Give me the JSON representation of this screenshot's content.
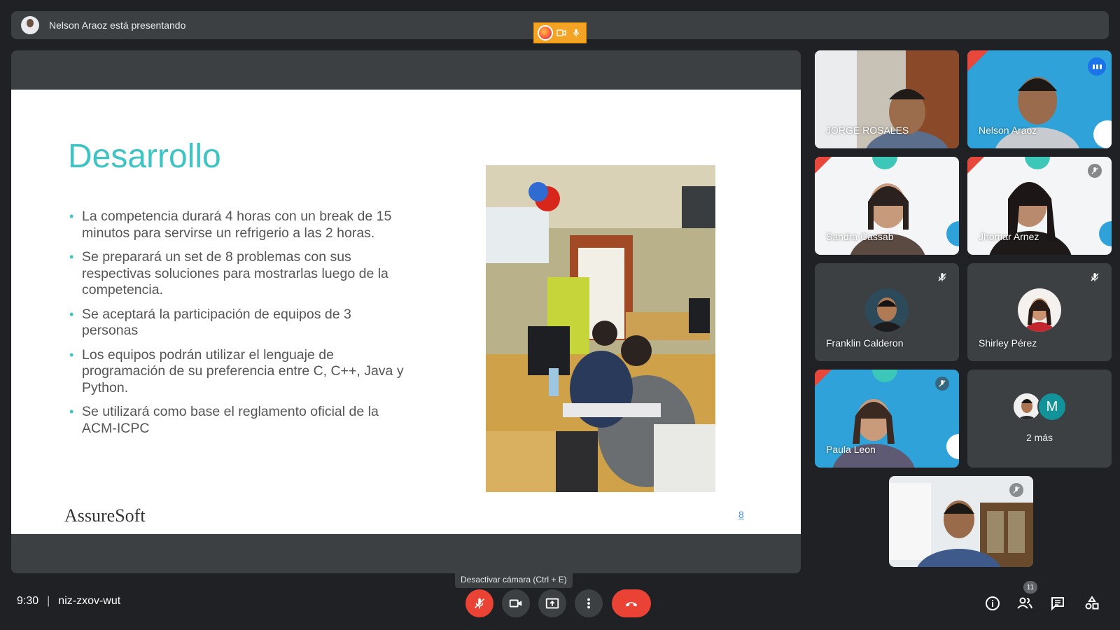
{
  "presenter": {
    "text": "Nelson Araoz está presentando"
  },
  "slide": {
    "title": "Desarrollo",
    "bullets": [
      "La competencia durará 4 horas con un break de 15 minutos para servirse un refrigerio a las 2 horas.",
      "Se preparará un set de 8 problemas con sus respectivas soluciones para mostrarlas luego de la competencia.",
      "Se aceptará la participación de equipos de 3 personas",
      "Los equipos podrán utilizar el lenguaje de programación de su preferencia entre C, C++, Java y Python.",
      "Se utilizará como base el reglamento oficial de la ACM-ICPC"
    ],
    "logo": "AssureSoft",
    "page_number": "8"
  },
  "participants": [
    {
      "name": "JORGE ROSALES"
    },
    {
      "name": "Nelson Araoz"
    },
    {
      "name": "Sandra Cassab"
    },
    {
      "name": "Jhomar Arnez"
    },
    {
      "name": "Franklin Calderon"
    },
    {
      "name": "Shirley Pérez"
    },
    {
      "name": "Paula Leon"
    }
  ],
  "more_tile": {
    "text": "2 más",
    "avatar_letter": "M"
  },
  "meeting": {
    "time": "9:30",
    "code": "niz-zxov-wut"
  },
  "tooltip": "Desactivar cámara (Ctrl + E)",
  "participant_count": "11",
  "colors": {
    "accent": "#3ec4c4",
    "danger": "#ea4335",
    "speaking_border": "#8ab4f8"
  },
  "icons": [
    "firefox-icon",
    "camera-icon",
    "mic-icon",
    "mic-off-icon",
    "present-icon",
    "more-vert-icon",
    "hangup-icon",
    "info-icon",
    "people-icon",
    "chat-icon",
    "activities-icon"
  ]
}
